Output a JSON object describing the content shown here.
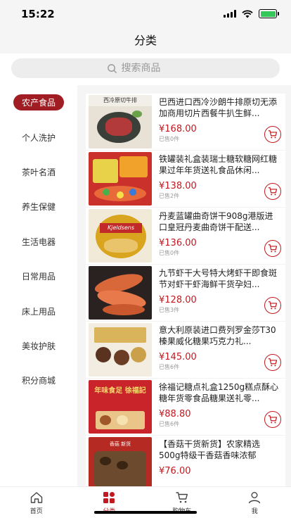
{
  "status": {
    "time": "15:22"
  },
  "header": {
    "title": "分类"
  },
  "search": {
    "placeholder": "搜索商品"
  },
  "sidebar": {
    "items": [
      {
        "label": "农产食品",
        "active": true
      },
      {
        "label": "个人洗护"
      },
      {
        "label": "茶叶名酒"
      },
      {
        "label": "养生保健"
      },
      {
        "label": "生活电器"
      },
      {
        "label": "日常用品"
      },
      {
        "label": "床上用品"
      },
      {
        "label": "美妆护肤"
      },
      {
        "label": "积分商城"
      }
    ]
  },
  "products": [
    {
      "title": "巴西进口西冷沙朗牛排原切无添加商用切片西餐牛扒生鲜...",
      "price": "¥168.00",
      "sold": "已售0件",
      "img_label": "西冷原切牛排"
    },
    {
      "title": "铁罐装礼盒装瑞士糖软糖网红糖果过年年货送礼食品休闲...",
      "price": "¥138.00",
      "sold": "已售2件",
      "img_label": ""
    },
    {
      "title": "丹麦蓝罐曲奇饼干908g港版进口皇冠丹麦曲奇饼干配送...",
      "price": "¥136.00",
      "sold": "已售0件",
      "img_label": "Kjeldsens"
    },
    {
      "title": "九节虾干大号特大烤虾干即食斑节对虾干虾海鲜干货孕妇...",
      "price": "¥128.00",
      "sold": "已售3件",
      "img_label": ""
    },
    {
      "title": "意大利原装进口费列罗金莎T30榛果威化糖果巧克力礼...",
      "price": "¥145.00",
      "sold": "已售6件",
      "img_label": ""
    },
    {
      "title": "徐福记糖点礼盒1250g糕点酥心糖年货零食品糖果送礼零...",
      "price": "¥88.80",
      "sold": "已售6件",
      "img_label": "年味食足 徐福記"
    },
    {
      "title": "【香菇干货新货】农家精选500g特级干香菇香味浓郁",
      "price": "¥76.00",
      "sold": "",
      "img_label": "香菇 新货"
    }
  ],
  "tabbar": {
    "items": [
      {
        "label": "首页",
        "icon": "home-icon"
      },
      {
        "label": "分类",
        "icon": "category-icon",
        "active": true
      },
      {
        "label": "购物车",
        "icon": "cart-icon"
      },
      {
        "label": "我",
        "icon": "user-icon"
      }
    ]
  },
  "colors": {
    "accent": "#c2181f",
    "active_bg": "#a11d24"
  }
}
